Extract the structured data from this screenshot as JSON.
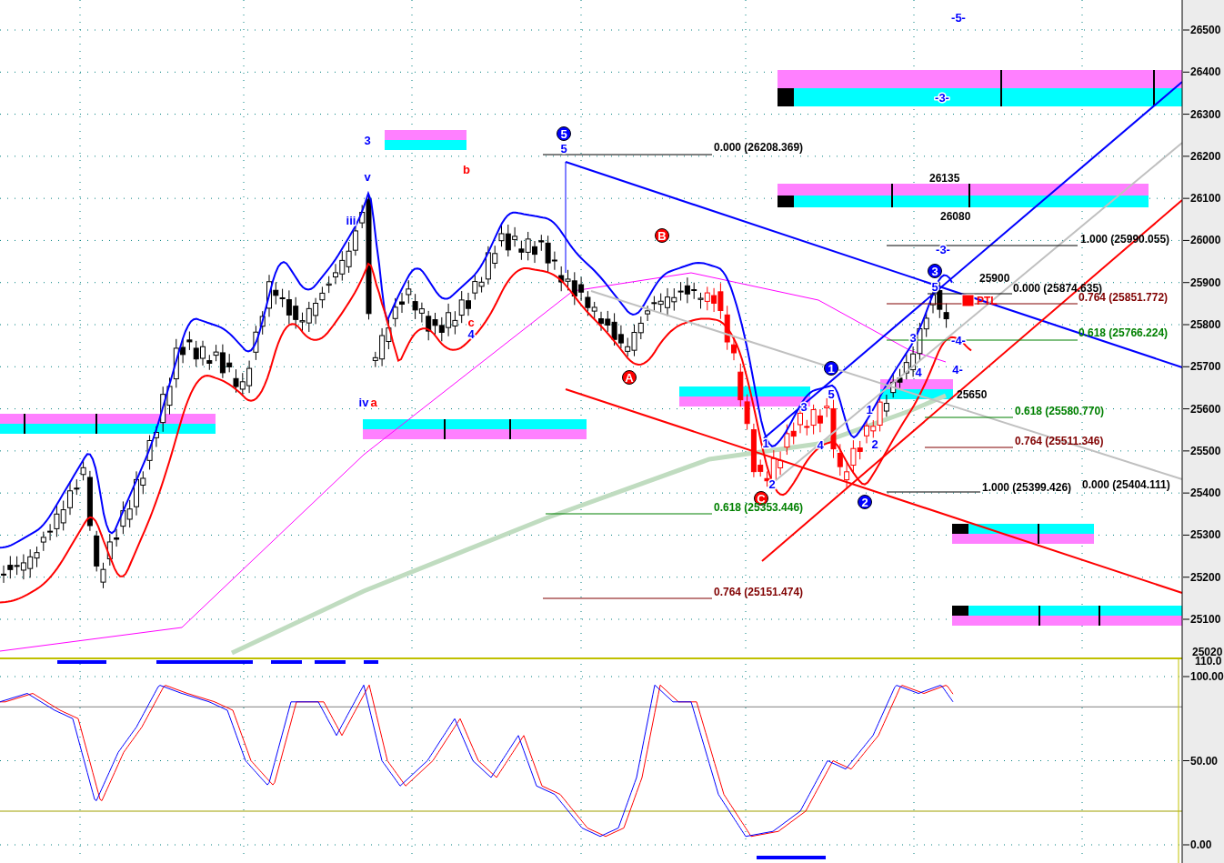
{
  "price_pane": {
    "axis_labels": [
      "26500",
      "26400",
      "26300",
      "26200",
      "26100",
      "26000",
      "25900",
      "25800",
      "25700",
      "25600",
      "25500",
      "25400",
      "25300",
      "25200",
      "25100"
    ],
    "cut_label": "25020",
    "annotations": [
      {
        "text": "-5-",
        "kind": "wave",
        "color": "#0000ff"
      },
      {
        "text": "-3-",
        "kind": "wave",
        "color": "#0000ff"
      },
      {
        "text": "3",
        "kind": "wave",
        "color": "#0000ff"
      },
      {
        "text": "5",
        "kind": "circled",
        "color": "#0000ff"
      },
      {
        "text": "5",
        "kind": "wave",
        "color": "#0000ff"
      },
      {
        "text": "0.000 (26208.369)",
        "kind": "fib",
        "color": "#000000"
      },
      {
        "text": "v",
        "kind": "wave",
        "color": "#0000ff"
      },
      {
        "text": "b",
        "kind": "wave",
        "color": "#ff0000"
      },
      {
        "text": "26135",
        "kind": "price",
        "color": "#000000"
      },
      {
        "text": "iii",
        "kind": "wave",
        "color": "#0000ff"
      },
      {
        "text": "26080",
        "kind": "price",
        "color": "#000000"
      },
      {
        "text": "B",
        "kind": "circled",
        "color": "#ff0000"
      },
      {
        "text": "1.000 (25990.055)",
        "kind": "fib",
        "color": "#000000"
      },
      {
        "text": "-3-",
        "kind": "wave",
        "color": "#0000ff"
      },
      {
        "text": "3",
        "kind": "circled",
        "color": "#0000ff"
      },
      {
        "text": "25900",
        "kind": "price",
        "color": "#000000"
      },
      {
        "text": "5",
        "kind": "wave",
        "color": "#0000ff"
      },
      {
        "text": "0.000 (25874.635)",
        "kind": "fib",
        "color": "#000000"
      },
      {
        "text": "PTL",
        "kind": "marker",
        "color": "#ff0000"
      },
      {
        "text": "0.764 (25851.772)",
        "kind": "fib",
        "color": "#800000"
      },
      {
        "text": "c",
        "kind": "wave",
        "color": "#ff0000"
      },
      {
        "text": "4",
        "kind": "wave",
        "color": "#0000ff"
      },
      {
        "text": "3",
        "kind": "wave",
        "color": "#0000ff"
      },
      {
        "text": "-4-",
        "kind": "wave",
        "color": "#0000ff"
      },
      {
        "text": "0.618 (25766.224)",
        "kind": "fib",
        "color": "#008000"
      },
      {
        "text": "1",
        "kind": "circled",
        "color": "#0000ff"
      },
      {
        "text": "A",
        "kind": "circled",
        "color": "#ff0000"
      },
      {
        "text": "4",
        "kind": "wave",
        "color": "#0000ff"
      },
      {
        "text": "4-",
        "kind": "wave",
        "color": "#0000ff"
      },
      {
        "text": "5",
        "kind": "wave",
        "color": "#0000ff"
      },
      {
        "text": "25650",
        "kind": "price",
        "color": "#000000"
      },
      {
        "text": "iv",
        "kind": "wave",
        "color": "#0000ff"
      },
      {
        "text": "a",
        "kind": "wave",
        "color": "#ff0000"
      },
      {
        "text": "3",
        "kind": "wave",
        "color": "#0000ff"
      },
      {
        "text": "1",
        "kind": "wave",
        "color": "#0000ff"
      },
      {
        "text": "0.618 (25580.770)",
        "kind": "fib",
        "color": "#008000"
      },
      {
        "text": "1",
        "kind": "wave",
        "color": "#0000ff"
      },
      {
        "text": "4",
        "kind": "wave",
        "color": "#0000ff"
      },
      {
        "text": "2",
        "kind": "wave",
        "color": "#0000ff"
      },
      {
        "text": "0.764 (25511.346)",
        "kind": "fib",
        "color": "#800000"
      },
      {
        "text": "1.000 (25399.426)",
        "kind": "fib",
        "color": "#000000"
      },
      {
        "text": "0.000 (25404.111)",
        "kind": "fib",
        "color": "#000000"
      },
      {
        "text": "2",
        "kind": "circled",
        "color": "#0000ff"
      },
      {
        "text": "2",
        "kind": "wave",
        "color": "#0000ff"
      },
      {
        "text": "C",
        "kind": "circled",
        "color": "#ff0000"
      },
      {
        "text": "0.618 (25353.446)",
        "kind": "fib",
        "color": "#008000"
      },
      {
        "text": "0.764 (25151.474)",
        "kind": "fib",
        "color": "#800000"
      }
    ]
  },
  "oscillator_pane": {
    "cut_label": "110.0",
    "axis_labels": [
      "100.00",
      "50.00",
      "0.00"
    ]
  }
}
